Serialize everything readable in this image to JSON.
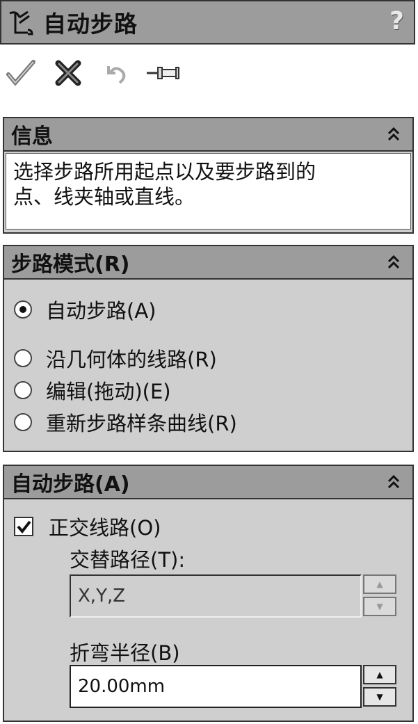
{
  "window": {
    "title": "自动步路",
    "help_label": "?"
  },
  "actions": {
    "ok": "check-icon",
    "cancel": "x-icon",
    "undo": "undo-icon",
    "pin": "pin-icon"
  },
  "info": {
    "header": "信息",
    "text_line1": "选择步路所用起点以及要步路到的",
    "text_line2": "点、线夹轴或直线。"
  },
  "mode": {
    "header": "步路模式(R)",
    "options": [
      {
        "label": "自动步路(A)",
        "selected": true
      },
      {
        "label": "沿几何体的线路(R)",
        "selected": false
      },
      {
        "label": "编辑(拖动)(E)",
        "selected": false
      },
      {
        "label": "重新步路样条曲线(R)",
        "selected": false
      }
    ]
  },
  "auto": {
    "header": "自动步路(A)",
    "orthogonal_label": "正交线路(O)",
    "orthogonal_checked": true,
    "alt_path_label": "交替路径(T):",
    "alt_path_value": "X,Y,Z",
    "bend_radius_label": "折弯半径(B)",
    "bend_radius_value": "20.00mm"
  },
  "colors": {
    "header_gray": "#9c9c9c",
    "panel_gray": "#cfcfcf"
  }
}
